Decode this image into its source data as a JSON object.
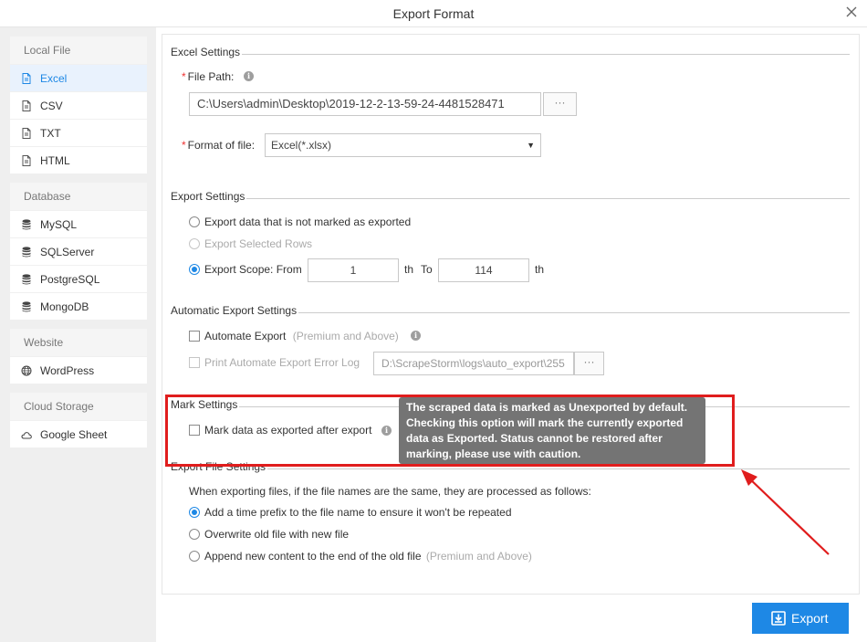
{
  "window": {
    "title": "Export Format"
  },
  "sidebar": {
    "groups": [
      {
        "heading": "Local File",
        "items": [
          {
            "label": "Excel",
            "icon": "file-icon"
          },
          {
            "label": "CSV",
            "icon": "file-icon"
          },
          {
            "label": "TXT",
            "icon": "file-icon"
          },
          {
            "label": "HTML",
            "icon": "file-icon"
          }
        ]
      },
      {
        "heading": "Database",
        "items": [
          {
            "label": "MySQL",
            "icon": "database-icon"
          },
          {
            "label": "SQLServer",
            "icon": "database-icon"
          },
          {
            "label": "PostgreSQL",
            "icon": "database-icon"
          },
          {
            "label": "MongoDB",
            "icon": "database-icon"
          }
        ]
      },
      {
        "heading": "Website",
        "items": [
          {
            "label": "WordPress",
            "icon": "globe-icon"
          }
        ]
      },
      {
        "heading": "Cloud Storage",
        "items": [
          {
            "label": "Google Sheet",
            "icon": "cloud-icon"
          }
        ]
      }
    ],
    "selected": "Excel"
  },
  "excel_settings": {
    "title": "Excel Settings",
    "file_path_label": "File Path:",
    "file_path_value": "C:\\Users\\admin\\Desktop\\2019-12-2-13-59-24-4481528471",
    "browse_label": "···",
    "format_label": "Format of file:",
    "format_value": "Excel(*.xlsx)"
  },
  "export_settings": {
    "title": "Export Settings",
    "option_unmarked": "Export data that is not marked as exported",
    "option_selected_rows": "Export Selected Rows",
    "option_scope": "Export Scope: From",
    "scope_from": "1",
    "th1": "th",
    "to_label": "To",
    "scope_to": "114",
    "th2": "th"
  },
  "auto_export": {
    "title": "Automatic Export Settings",
    "automate_label": "Automate Export",
    "automate_note": "(Premium and Above)",
    "error_log_label": "Print Automate Export Error Log",
    "error_log_path": "D:\\ScrapeStorm\\logs\\auto_export\\255",
    "browse_label": "···"
  },
  "mark_settings": {
    "title": "Mark Settings",
    "mark_label": "Mark data as exported after export",
    "tooltip": "The scraped data is marked as Unexported by default. Checking this option will mark the currently exported data as Exported. Status cannot be restored after marking, please use with caution."
  },
  "file_settings": {
    "title": "Export File Settings",
    "intro": "When exporting files, if the file names are the same, they are processed as follows:",
    "option_prefix": "Add a time prefix to the file name to ensure it won't be repeated",
    "option_overwrite": "Overwrite old file with new file",
    "option_append": "Append new content to the end of the old file",
    "append_note": "(Premium and Above)"
  },
  "footer": {
    "export_label": "Export"
  },
  "colors": {
    "accent": "#1e88e5",
    "highlight": "#e01d1d",
    "required": "#e33333"
  }
}
